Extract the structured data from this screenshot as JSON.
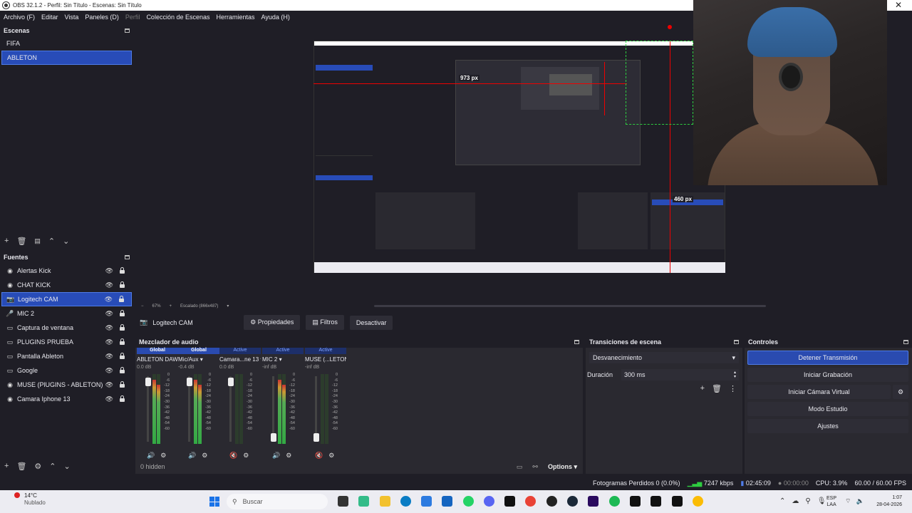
{
  "window": {
    "title": "OBS 32.1.2 - Perfil: Sin Título - Escenas: Sin Título",
    "close_glyph": "✕"
  },
  "menu": [
    "Archivo (F)",
    "Editar",
    "Vista",
    "Paneles (D)",
    "Perfil",
    "Colección de Escenas",
    "Herramientas",
    "Ayuda (H)"
  ],
  "scenes": {
    "title": "Escenas",
    "items": [
      {
        "label": "FIFA",
        "selected": false
      },
      {
        "label": "ABLETON",
        "selected": true
      }
    ]
  },
  "sources": {
    "title": "Fuentes",
    "items": [
      {
        "label": "Alertas Kick",
        "icon": "browser-icon"
      },
      {
        "label": "CHAT KICK",
        "icon": "browser-icon"
      },
      {
        "label": "Logitech CAM",
        "icon": "camera-icon",
        "selected": true
      },
      {
        "label": "MIC 2",
        "icon": "mic-icon"
      },
      {
        "label": "Captura de ventana",
        "icon": "window-icon"
      },
      {
        "label": "PLUGINS PRUEBA",
        "icon": "window-icon"
      },
      {
        "label": "Pantalla Ableton",
        "icon": "monitor-icon"
      },
      {
        "label": "Google",
        "icon": "window-icon"
      },
      {
        "label": "MUSE (PlUGINS - ABLETON)",
        "icon": "browser-icon"
      },
      {
        "label": "Camara Iphone 13",
        "icon": "browser-icon"
      }
    ]
  },
  "preview": {
    "measure_top": "973 px",
    "measure_right": "460 px",
    "zoom": "67%",
    "scaling": "Escalado (866x487)"
  },
  "source_toolbar": {
    "name": "Logitech CAM",
    "properties": "Propiedades",
    "filters": "Filtros",
    "deactivate": "Desactivar"
  },
  "mixer": {
    "title": "Mezclador de audio",
    "footer_hidden": "0 hidden",
    "options": "Options",
    "scale": [
      "0",
      "-6",
      "-12",
      "-18",
      "-24",
      "-30",
      "-36",
      "-42",
      "-48",
      "-54",
      "-60"
    ],
    "channels": [
      {
        "badge": "Global",
        "name": "ABLETON DAW",
        "db": "0.0 dB",
        "level": 0.98,
        "muted": false
      },
      {
        "badge": "Global",
        "name": "Mic/Aux",
        "db": "-0.4 dB",
        "level": 0.97,
        "muted": false
      },
      {
        "badge": "Active",
        "name": "Camara...ne 13",
        "db": "0.0 dB",
        "level": 0.98,
        "muted": true
      },
      {
        "badge": "Active",
        "name": "MIC 2",
        "db": "-inf dB",
        "level": 0.0,
        "muted": false
      },
      {
        "badge": "Active",
        "name": "MUSE (...LETON)",
        "db": "-inf dB",
        "level": 0.0,
        "muted": true
      }
    ]
  },
  "transitions": {
    "title": "Transiciones de escena",
    "selected": "Desvanecimiento",
    "duration_label": "Duración",
    "duration_value": "300 ms"
  },
  "controls": {
    "title": "Controles",
    "stop_stream": "Detener Transmisión",
    "start_recording": "Iniciar Grabación",
    "start_virtual_cam": "Iniciar Cámara Virtual",
    "studio_mode": "Modo Estudio",
    "settings": "Ajustes"
  },
  "status": {
    "dropped_frames": "Fotogramas Perdidos 0 (0.0%)",
    "bitrate": "7247 kbps",
    "stream_time": "02:45:09",
    "record_time": "00:00:00",
    "cpu": "CPU: 3.9%",
    "fps": "60.00 / 60.00 FPS"
  },
  "taskbar": {
    "weather_temp": "14°C",
    "weather_desc": "Nublado",
    "search": "Buscar",
    "lang_top": "ESP",
    "lang_bottom": "LAA",
    "time": "1:07",
    "date": "28-04-2026"
  },
  "colors": {
    "accent": "#284cb8",
    "panel": "#2a2930",
    "background": "#1f1e26",
    "guide": "#e00000",
    "selection": "#2ecc40"
  }
}
